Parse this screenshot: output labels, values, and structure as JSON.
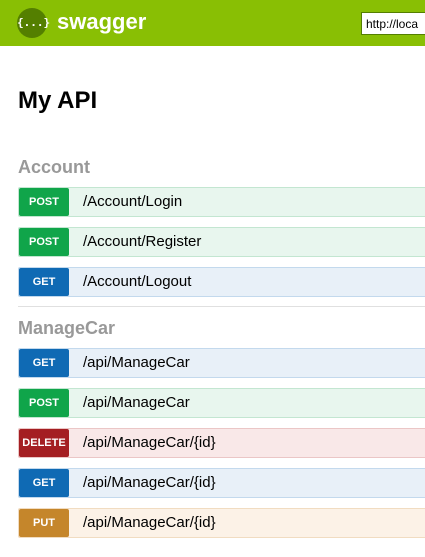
{
  "header": {
    "logo_glyph": "{...}",
    "brand": "swagger",
    "url_value": "http://loca"
  },
  "page": {
    "title": "My API"
  },
  "sections": [
    {
      "title": "Account",
      "operations": [
        {
          "method": "POST",
          "path": "/Account/Login"
        },
        {
          "method": "POST",
          "path": "/Account/Register"
        },
        {
          "method": "GET",
          "path": "/Account/Logout"
        }
      ]
    },
    {
      "title": "ManageCar",
      "operations": [
        {
          "method": "GET",
          "path": "/api/ManageCar"
        },
        {
          "method": "POST",
          "path": "/api/ManageCar"
        },
        {
          "method": "DELETE",
          "path": "/api/ManageCar/{id}"
        },
        {
          "method": "GET",
          "path": "/api/ManageCar/{id}"
        },
        {
          "method": "PUT",
          "path": "/api/ManageCar/{id}"
        }
      ]
    }
  ],
  "colors": {
    "topbar": "#89bf04",
    "post": "#10a54a",
    "get": "#0f6ab4",
    "delete": "#a41e22",
    "put": "#c5862b"
  }
}
